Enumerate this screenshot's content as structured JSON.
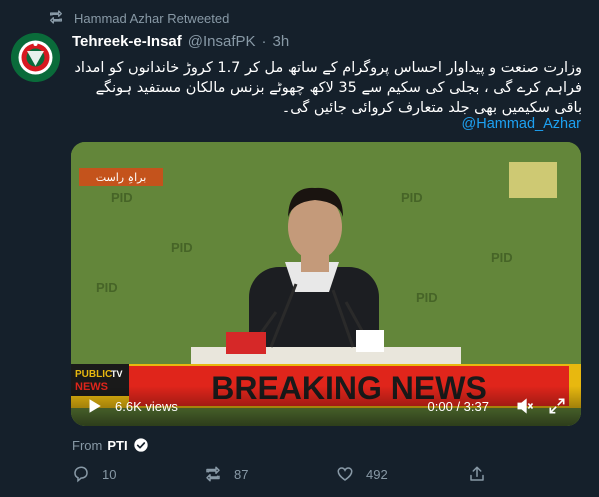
{
  "retweet_label": "Hammad Azhar Retweeted",
  "tweet": {
    "display_name": "Tehreek-e-Insaf",
    "handle": "@InsafPK",
    "separator": "·",
    "time": "3h",
    "text_line_1": "وزارت صنعت و پیداوار احساس پروگرام کے ساتھ مل کر 1.7 کروڑ خاندانوں کو امداد",
    "text_line_2": "فراہم کرے گی ، بجلی کی سکیم سے 35 لاکھ  چھوٹے بزنس مالکان مستفید ہونگے",
    "text_line_3": "باقی سکیمیں بھی جلد متعارف کروائی جائیں گی۔",
    "mention": "@Hammad_Azhar"
  },
  "video": {
    "views": "6.6K views",
    "progress": "0:00 / 3:37",
    "breaking_news": "BREAKING NEWS",
    "channel_top": "PUBLIC",
    "channel_tv": "TV",
    "channel_news": "NEWS",
    "urdu_tag": "براہِ راست",
    "watermark": "PID"
  },
  "source": {
    "prefix": "From",
    "name": "PTI"
  },
  "actions": {
    "replies": "10",
    "retweets": "87",
    "likes": "492"
  },
  "colors": {
    "background": "#15202b",
    "secondary_text": "#8899a6",
    "link": "#1da1f2",
    "breaking_red": "#e0251b",
    "ticker_yellow": "#e8b80f",
    "backdrop_green": "#5a7d35"
  },
  "icons": [
    "retweet-icon",
    "play-icon",
    "volume-icon",
    "fullscreen-icon",
    "verified-badge-icon",
    "reply-icon",
    "like-icon",
    "share-icon"
  ]
}
